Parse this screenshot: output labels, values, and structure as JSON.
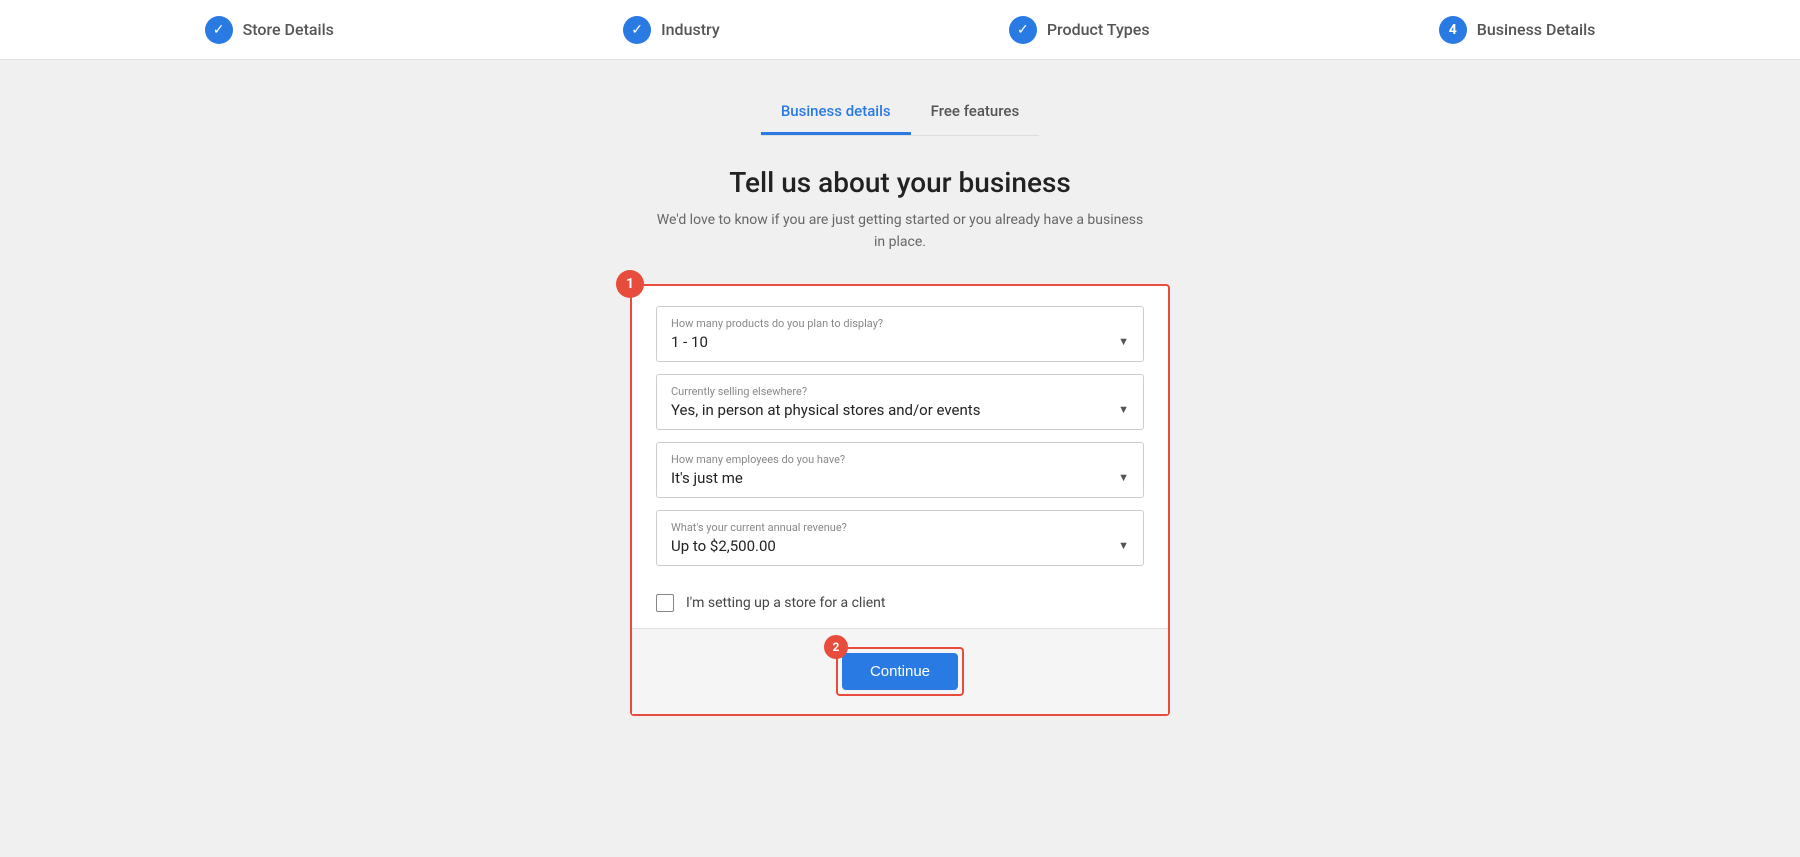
{
  "stepper": {
    "steps": [
      {
        "label": "Store Details",
        "type": "check",
        "num": 1
      },
      {
        "label": "Industry",
        "type": "check",
        "num": 2
      },
      {
        "label": "Product Types",
        "type": "check",
        "num": 3
      },
      {
        "label": "Business Details",
        "type": "num",
        "num": 4
      }
    ]
  },
  "tabs": [
    {
      "label": "Business details",
      "active": true
    },
    {
      "label": "Free features",
      "active": false
    }
  ],
  "heading": {
    "title": "Tell us about your business",
    "subtitle": "We'd love to know if you are just getting started or you already have a business in place."
  },
  "form": {
    "fields": [
      {
        "label": "How many products do you plan to display?",
        "value": "1 - 10"
      },
      {
        "label": "Currently selling elsewhere?",
        "value": "Yes, in person at physical stores and/or events"
      },
      {
        "label": "How many employees do you have?",
        "value": "It's just me"
      },
      {
        "label": "What's your current annual revenue?",
        "value": "Up to $2,500.00"
      }
    ],
    "checkbox_label": "I'm setting up a store for a client",
    "annotation_1": "1",
    "annotation_2": "2",
    "continue_label": "Continue"
  }
}
